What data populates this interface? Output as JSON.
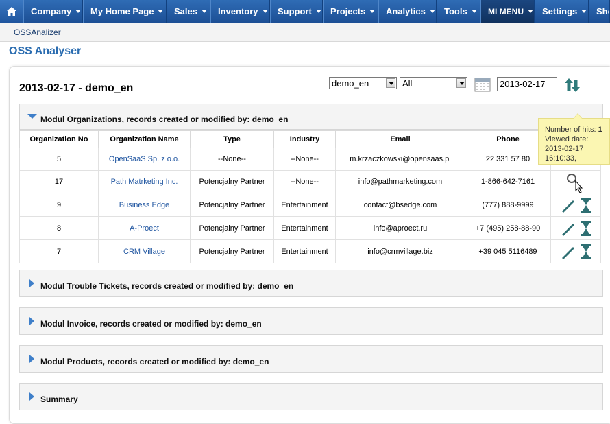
{
  "nav": {
    "items": [
      {
        "label": "Company"
      },
      {
        "label": "My Home Page"
      },
      {
        "label": "Sales"
      },
      {
        "label": "Inventory"
      },
      {
        "label": "Support"
      },
      {
        "label": "Projects"
      },
      {
        "label": "Analytics"
      },
      {
        "label": "Tools"
      },
      {
        "label": "MI MENU"
      },
      {
        "label": "Settings"
      },
      {
        "label": "Sho"
      }
    ]
  },
  "breadcrumb": "OSSAnalizer",
  "page_title": "OSS Analyser",
  "report": {
    "title": "2013-02-17 - demo_en",
    "user_select": "demo_en",
    "filter_select": "All",
    "date": "2013-02-17"
  },
  "sections": {
    "organizations": "Modul Organizations, records created or modified by: demo_en",
    "trouble_tickets": "Modul Trouble Tickets, records created or modified by: demo_en",
    "invoice": "Modul Invoice, records created or modified by: demo_en",
    "products": "Modul Products, records created or modified by: demo_en",
    "summary": "Summary"
  },
  "table": {
    "headers": [
      "Organization No",
      "Organization Name",
      "Type",
      "Industry",
      "Email",
      "Phone"
    ],
    "rows": [
      {
        "no": "5",
        "name": "OpenSaaS Sp. z o.o.",
        "type": "--None--",
        "industry": "--None--",
        "email": "m.krzaczkowski@opensaas.pl",
        "phone": "22 331 57 80"
      },
      {
        "no": "17",
        "name": "Path Matrketing Inc.",
        "type": "Potencjalny Partner",
        "industry": "--None--",
        "email": "info@pathmarketing.com",
        "phone": "1-866-642-7161"
      },
      {
        "no": "9",
        "name": "Business Edge",
        "type": "Potencjalny Partner",
        "industry": "Entertainment",
        "email": "contact@bsedge.com",
        "phone": "(777) 888-9999"
      },
      {
        "no": "8",
        "name": "A-Proect",
        "type": "Potencjalny Partner",
        "industry": "Entertainment",
        "email": "info@aproect.ru",
        "phone": "+7 (495) 258-88-90"
      },
      {
        "no": "7",
        "name": "CRM Village",
        "type": "Potencjalny Partner",
        "industry": "Entertainment",
        "email": "info@crmvillage.biz",
        "phone": "+39 045 5116489"
      }
    ]
  },
  "tooltip": {
    "hits_label": "Number of hits:",
    "hits_value": "1",
    "viewed_label": "Viewed date:",
    "viewed_date": "2013-02-17",
    "viewed_time": "16:10:33,"
  },
  "icons": {
    "home": "home-icon",
    "calendar": "calendar-icon",
    "sort": "sort-arrows-icon",
    "edit": "pencil-icon",
    "history": "hourglass-icon",
    "view": "magnifier-icon"
  },
  "colors": {
    "nav_bg": "#2f6cb5",
    "nav_active": "#10315e",
    "link": "#1f55a0",
    "title": "#2a6cb0",
    "tooltip_bg": "#fbf6b2",
    "icon_teal": "#2e6f72",
    "triangle": "#3f7fc9"
  }
}
